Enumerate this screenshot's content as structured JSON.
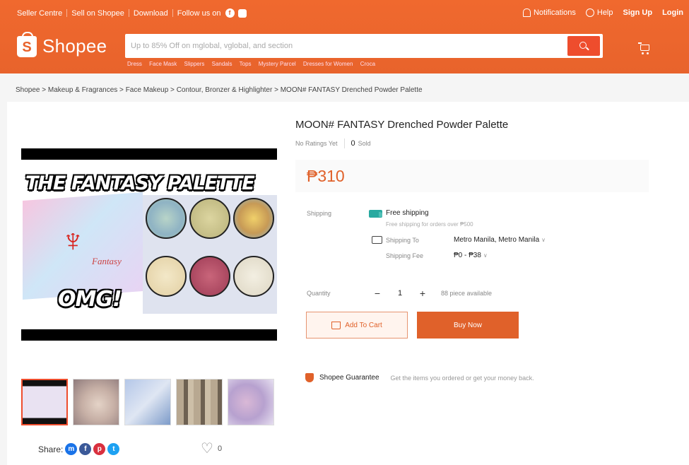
{
  "topbar": {
    "seller_centre": "Seller Centre",
    "sell_on_shopee": "Sell on Shopee",
    "download": "Download",
    "follow_us": "Follow us on",
    "notifications": "Notifications",
    "help": "Help",
    "sign_up": "Sign Up",
    "login": "Login"
  },
  "brand": {
    "logo_letter": "S",
    "name": "Shopee",
    "color": "#ee4d2d"
  },
  "search": {
    "placeholder": "Up to 85% Off on mglobal, vglobal, and section",
    "keywords": [
      "Dress",
      "Face Mask",
      "Slippers",
      "Sandals",
      "Tops",
      "Mystery Parcel",
      "Dresses for Women",
      "Croca"
    ]
  },
  "breadcrumb": [
    "Shopee",
    "Makeup & Fragrances",
    "Face Makeup",
    "Contour, Bronzer & Highlighter",
    "MOON# FANTASY Drenched Powder Palette"
  ],
  "product": {
    "title": "MOON# FANTASY Drenched Powder Palette",
    "ratings": "No Ratings Yet",
    "sold_count": "0",
    "sold_label": "Sold",
    "price": "₱310",
    "image_title": "THE FANTASY PALETTE",
    "image_omg": "OMG!",
    "image_fantasy": "Fantasy"
  },
  "shipping": {
    "label": "Shipping",
    "free": "Free shipping",
    "free_note": "Free shipping for orders over ₱500",
    "to_label": "Shipping To",
    "to_value": "Metro Manila, Metro Manila",
    "fee_label": "Shipping Fee",
    "fee_value": "₱0 - ₱38"
  },
  "quantity": {
    "label": "Quantity",
    "minus": "−",
    "value": "1",
    "plus": "+",
    "available": "88 piece available"
  },
  "actions": {
    "add_to_cart": "Add To Cart",
    "buy_now": "Buy Now",
    "accent": "#e0612a"
  },
  "guarantee": {
    "title": "Shopee Guarantee",
    "text": "Get the items you ordered or get your money back."
  },
  "share": {
    "label": "Share:",
    "favorites": "0"
  }
}
